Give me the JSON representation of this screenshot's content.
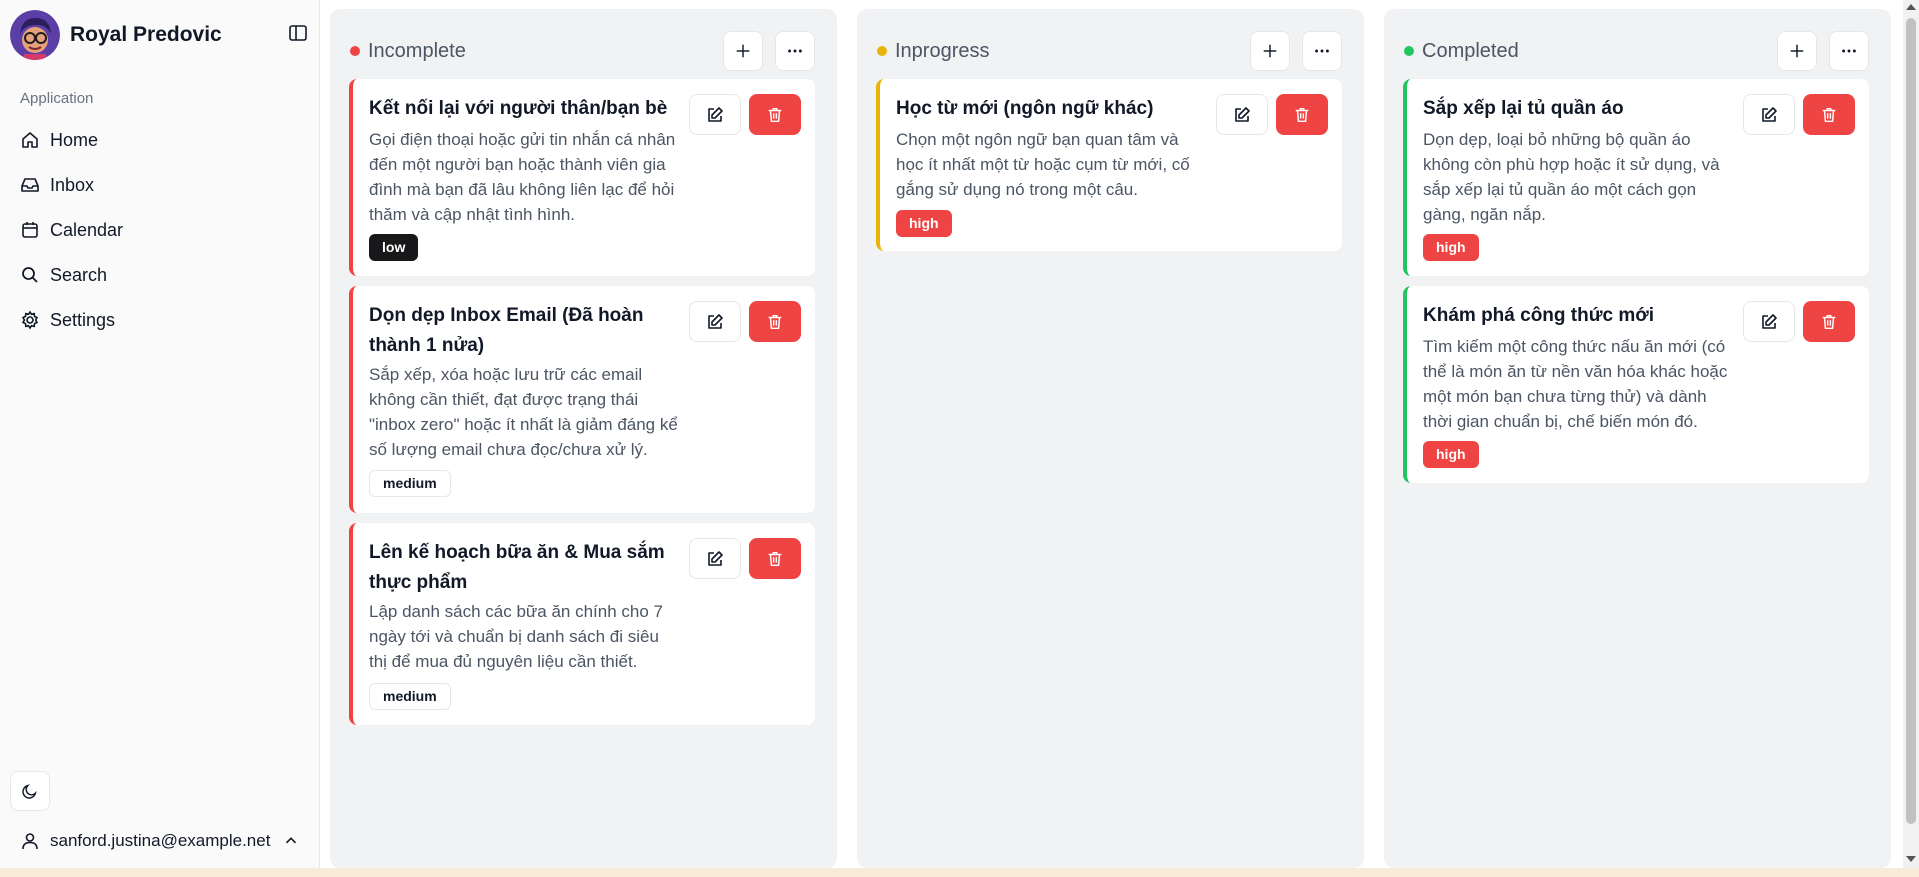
{
  "profile": {
    "name": "Royal Predovic"
  },
  "sidebar": {
    "section_label": "Application",
    "items": [
      {
        "label": "Home",
        "icon": "home-icon"
      },
      {
        "label": "Inbox",
        "icon": "inbox-icon"
      },
      {
        "label": "Calendar",
        "icon": "calendar-icon"
      },
      {
        "label": "Search",
        "icon": "search-icon"
      },
      {
        "label": "Settings",
        "icon": "gear-icon"
      }
    ],
    "user_email": "sanford.justina@example.net"
  },
  "colors": {
    "incomplete": "#ef4444",
    "inprogress": "#eab308",
    "completed": "#22c55e",
    "delete": "#ef4444"
  },
  "columns": [
    {
      "title": "Incomplete",
      "cards": [
        {
          "title": "Kết nối lại với người thân/bạn bè",
          "description": "Gọi điện thoại hoặc gửi tin nhắn cá nhân đến một người bạn hoặc thành viên gia đình mà bạn đã lâu không liên lạc để hỏi thăm và cập nhật tình hình.",
          "priority": "low"
        },
        {
          "title": "Dọn dẹp Inbox Email (Đã hoàn thành 1 nửa)",
          "description": "Sắp xếp, xóa hoặc lưu trữ các email không cần thiết, đạt được trạng thái \"inbox zero\" hoặc ít nhất là giảm đáng kể số lượng email chưa đọc/chưa xử lý.",
          "priority": "medium"
        },
        {
          "title": "Lên kế hoạch bữa ăn & Mua sắm thực phẩm",
          "description": "Lập danh sách các bữa ăn chính cho 7 ngày tới và chuẩn bị danh sách đi siêu thị để mua đủ nguyên liệu cần thiết.",
          "priority": "medium"
        }
      ]
    },
    {
      "title": "Inprogress",
      "cards": [
        {
          "title": "Học từ mới (ngôn ngữ khác)",
          "description": "Chọn một ngôn ngữ bạn quan tâm và học ít nhất một từ hoặc cụm từ mới, cố gắng sử dụng nó trong một câu.",
          "priority": "high"
        }
      ]
    },
    {
      "title": "Completed",
      "cards": [
        {
          "title": "Sắp xếp lại tủ quần áo",
          "description": "Dọn dẹp, loại bỏ những bộ quần áo không còn phù hợp hoặc ít sử dụng, và sắp xếp lại tủ quần áo một cách gọn gàng, ngăn nắp.",
          "priority": "high"
        },
        {
          "title": "Khám phá công thức mới",
          "description": "Tìm kiếm một công thức nấu ăn mới (có thể là món ăn từ nền văn hóa khác hoặc một món bạn chưa từng thử) và dành thời gian chuẩn bị, chế biến món đó.",
          "priority": "high"
        }
      ]
    }
  ]
}
